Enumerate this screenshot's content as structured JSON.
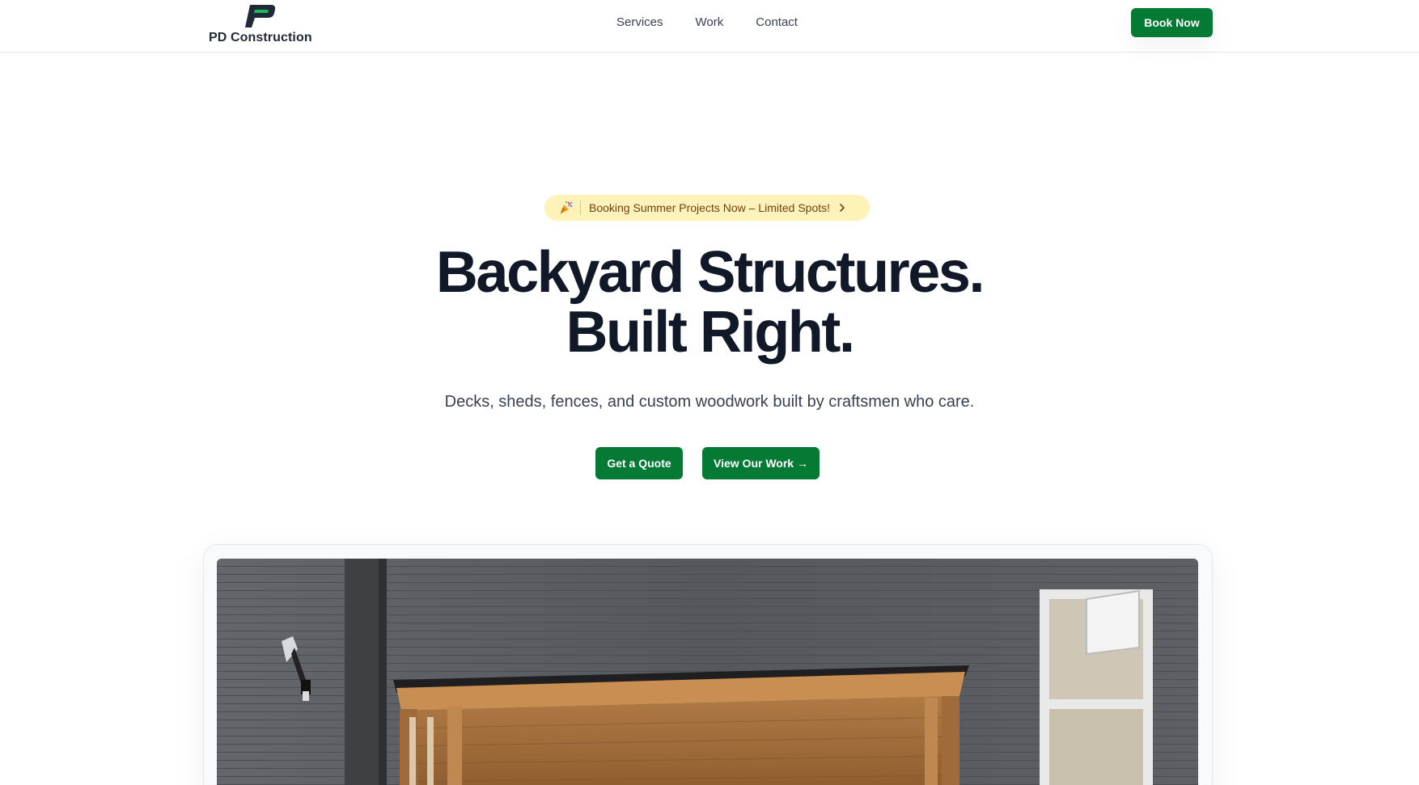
{
  "brand": {
    "name": "PD Construction",
    "logo_icon": "pd-logo-icon",
    "accent": "#1db954",
    "dark": "#111827"
  },
  "nav": {
    "items": [
      {
        "label": "Services"
      },
      {
        "label": "Work"
      },
      {
        "label": "Contact"
      }
    ]
  },
  "header": {
    "cta_label": "Book Now"
  },
  "hero": {
    "badge": {
      "emoji_icon": "party-popper-icon",
      "text": "Booking Summer Projects Now – Limited Spots!",
      "chevron_icon": "chevron-right-icon"
    },
    "headline_line1": "Backyard Structures.",
    "headline_line2": "Built Right.",
    "subheadline": "Decks, sheds, fences, and custom woodwork built by craftsmen who care.",
    "primary_cta": "Get a Quote",
    "secondary_cta": "View Our Work →"
  },
  "showcase": {
    "image": "wooden-shed-against-grey-siding"
  },
  "colors": {
    "button_green": "#057a35",
    "badge_bg": "#fdf2b8",
    "badge_text": "#713f12"
  }
}
